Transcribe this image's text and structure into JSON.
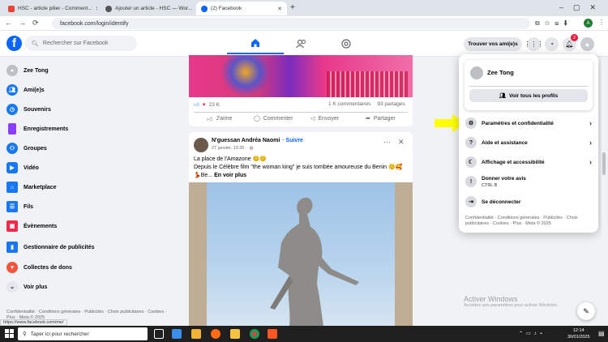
{
  "browser": {
    "tabs": [
      {
        "title": "HSC - article pilier - Comment...",
        "active": false
      },
      {
        "title": "Ajouter un article - HSC — Wor...",
        "active": false
      },
      {
        "title": "(2) Facebook",
        "active": true
      }
    ],
    "new_tab": "+",
    "url": "facebook.com/login/identify",
    "status_url": "https://www.facebook.com/me/",
    "profile_initial": "A"
  },
  "fb_header": {
    "search_placeholder": "Rechercher sur Facebook",
    "find_friends": "Trouver vos ami(e)s",
    "notif_count": "2",
    "logo": "f"
  },
  "sidebar": {
    "items": [
      {
        "label": "Zee Tong",
        "icon": "avatar"
      },
      {
        "label": "Ami(e)s",
        "icon": "friends-icon"
      },
      {
        "label": "Souvenirs",
        "icon": "memories-icon"
      },
      {
        "label": "Enregistrements",
        "icon": "saved-icon"
      },
      {
        "label": "Groupes",
        "icon": "groups-icon"
      },
      {
        "label": "Vidéo",
        "icon": "video-icon"
      },
      {
        "label": "Marketplace",
        "icon": "marketplace-icon"
      },
      {
        "label": "Fils",
        "icon": "feeds-icon"
      },
      {
        "label": "Évènements",
        "icon": "events-icon"
      },
      {
        "label": "Gestionnaire de publicités",
        "icon": "ads-manager-icon"
      },
      {
        "label": "Collectes de dons",
        "icon": "fundraisers-icon"
      },
      {
        "label": "Voir plus",
        "icon": "chevron-down-icon"
      }
    ],
    "footer": "Confidentialité · Conditions générales · Publicités · Choix publicitaires · Cookies · Plus · Meta © 2025"
  },
  "post1": {
    "reactions": "23 K",
    "comments": "1 K commentaires",
    "shares": "93 partages",
    "actions": [
      "J'aime",
      "Commenter",
      "Envoyer",
      "Partager"
    ]
  },
  "post2": {
    "author": "N'guessan Andréa Naomi",
    "follow": "· Suivre",
    "date": "27 janvier, 13:35 ·",
    "line1": "La place de l'Amazone 😊😊",
    "line2": "Depuis le Célèbre film \"the woman king\" je suis tombée amoureuse du Benin 😊🥰",
    "line3_prefix": "💃Be...",
    "see_more": "En voir plus"
  },
  "dropdown": {
    "profile_name": "Zee Tong",
    "view_profiles": "Voir tous les profils",
    "items": [
      {
        "label": "Paramètres et confidentialité",
        "sub": "",
        "chevron": true,
        "icon": "gear-icon"
      },
      {
        "label": "Aide et assistance",
        "sub": "",
        "chevron": true,
        "icon": "help-icon"
      },
      {
        "label": "Affichage et accessibilité",
        "sub": "",
        "chevron": true,
        "icon": "moon-icon"
      },
      {
        "label": "Donner votre avis",
        "sub": "CTRL B",
        "chevron": false,
        "icon": "feedback-icon"
      },
      {
        "label": "Se déconnecter",
        "sub": "",
        "chevron": false,
        "icon": "logout-icon"
      }
    ],
    "footer": "Confidentialité · Conditions générales · Publicités · Choix publicitaires · Cookies · Plus · Meta © 2025"
  },
  "windows": {
    "activate_title": "Activer Windows",
    "activate_sub": "Accédez aux paramètres pour activer Windows.",
    "search_placeholder": "Taper ici pour rechercher",
    "time": "12:14",
    "date": "30/01/2025"
  },
  "colors": {
    "fb_blue": "#0866ff",
    "arrow_yellow": "#ffff00",
    "bg": "#f0f2f5"
  }
}
